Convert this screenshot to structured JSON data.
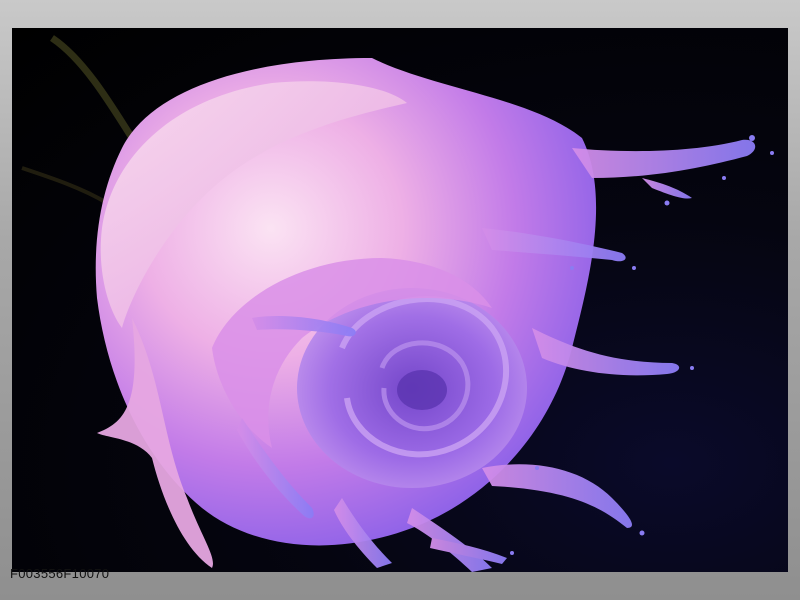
{
  "image": {
    "subject": "rose",
    "colors": {
      "background": "#000000",
      "petal_light": "#f7d6ef",
      "petal_pink": "#e88ee0",
      "petal_purple": "#9b5ee8",
      "petal_blue": "#6e5cf0"
    }
  },
  "caption": {
    "product_code": "F003556F10070"
  }
}
